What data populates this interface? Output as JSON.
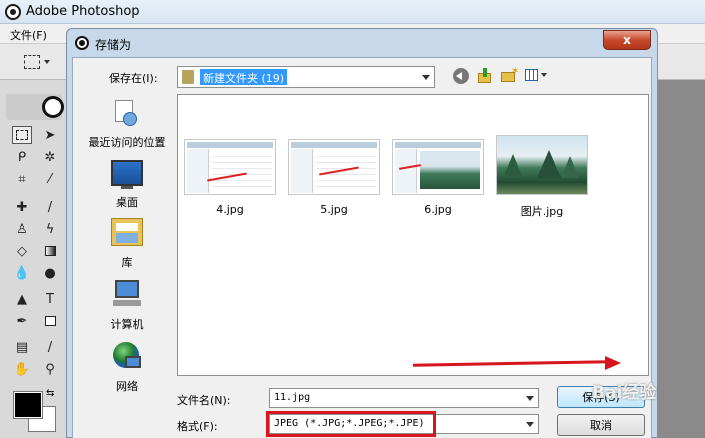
{
  "app": {
    "title": "Adobe Photoshop"
  },
  "menu": {
    "file_label": "文件(F)"
  },
  "dialog": {
    "title": "存储为",
    "close_label": "x",
    "save_in_label": "保存在(I):",
    "save_in_value": "新建文件夹 (19)",
    "places": [
      {
        "label": "最近访问的位置",
        "icon": "recent-places-icon"
      },
      {
        "label": "桌面",
        "icon": "desktop-icon"
      },
      {
        "label": "库",
        "icon": "library-icon"
      },
      {
        "label": "计算机",
        "icon": "computer-icon"
      },
      {
        "label": "网络",
        "icon": "network-icon"
      }
    ],
    "files": [
      {
        "name": "4.jpg",
        "kind": "screenshot"
      },
      {
        "name": "5.jpg",
        "kind": "screenshot"
      },
      {
        "name": "6.jpg",
        "kind": "screenshot"
      },
      {
        "name": "图片.jpg",
        "kind": "landscape"
      }
    ],
    "filename_label": "文件名(N):",
    "filename_value": "11.jpg",
    "format_label": "格式(F):",
    "format_value": "JPEG (*.JPG;*.JPEG;*.JPE)",
    "save_button": "保存(S)",
    "cancel_button": "取消"
  },
  "watermark": "Bai经验",
  "colors": {
    "accent": "#3399ff",
    "highlight_red": "#d8141e",
    "close_red": "#c84a2e"
  }
}
